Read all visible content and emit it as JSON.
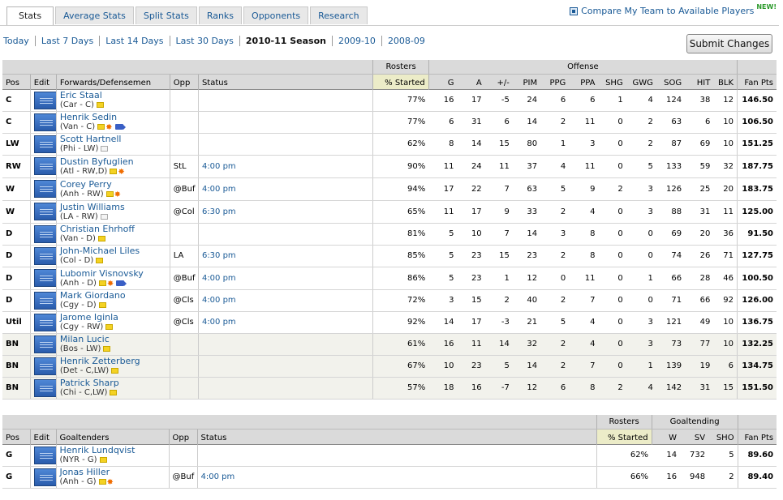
{
  "tabs": [
    "Stats",
    "Average Stats",
    "Split Stats",
    "Ranks",
    "Opponents",
    "Research"
  ],
  "compare_link": "Compare My Team to Available Players",
  "new_badge": "NEW!",
  "date_filters": [
    "Today",
    "Last 7 Days",
    "Last 14 Days",
    "Last 30 Days",
    "2010-11 Season",
    "2009-10",
    "2008-09"
  ],
  "submit_label": "Submit Changes",
  "skaters": {
    "group_rosters": "Rosters",
    "group_offense": "Offense",
    "headers": {
      "pos": "Pos",
      "edit": "Edit",
      "name": "Forwards/Defensemen",
      "opp": "Opp",
      "status": "Status",
      "pct": "% Started",
      "g": "G",
      "a": "A",
      "pm": "+/-",
      "pim": "PIM",
      "ppg": "PPG",
      "ppa": "PPA",
      "shg": "SHG",
      "gwg": "GWG",
      "sog": "SOG",
      "hit": "HIT",
      "blk": "BLK",
      "pts": "Fan Pts"
    },
    "rows": [
      {
        "pos": "C",
        "name": "Eric Staal",
        "info": "(Car - C)",
        "opp": "",
        "status": "",
        "pct": "77%",
        "g": "16",
        "a": "17",
        "pm": "-5",
        "pim": "24",
        "ppg": "6",
        "ppa": "6",
        "shg": "1",
        "gwg": "4",
        "sog": "124",
        "hit": "38",
        "blk": "12",
        "pts": "146.50"
      },
      {
        "pos": "C",
        "name": "Henrik Sedin",
        "info": "(Van - C)",
        "opp": "",
        "status": "",
        "pct": "77%",
        "g": "6",
        "a": "31",
        "pm": "6",
        "pim": "14",
        "ppg": "2",
        "ppa": "11",
        "shg": "0",
        "gwg": "2",
        "sog": "63",
        "hit": "6",
        "blk": "10",
        "pts": "106.50"
      },
      {
        "pos": "LW",
        "name": "Scott Hartnell",
        "info": "(Phi - LW)",
        "opp": "",
        "status": "",
        "pct": "62%",
        "g": "8",
        "a": "14",
        "pm": "15",
        "pim": "80",
        "ppg": "1",
        "ppa": "3",
        "shg": "0",
        "gwg": "2",
        "sog": "87",
        "hit": "69",
        "blk": "10",
        "pts": "151.25"
      },
      {
        "pos": "RW",
        "name": "Dustin Byfuglien",
        "info": "(Atl - RW,D)",
        "opp": "StL",
        "status": "4:00 pm",
        "pct": "90%",
        "g": "11",
        "a": "24",
        "pm": "11",
        "pim": "37",
        "ppg": "4",
        "ppa": "11",
        "shg": "0",
        "gwg": "5",
        "sog": "133",
        "hit": "59",
        "blk": "32",
        "pts": "187.75"
      },
      {
        "pos": "W",
        "name": "Corey Perry",
        "info": "(Anh - RW)",
        "opp": "@Buf",
        "status": "4:00 pm",
        "pct": "94%",
        "g": "17",
        "a": "22",
        "pm": "7",
        "pim": "63",
        "ppg": "5",
        "ppa": "9",
        "shg": "2",
        "gwg": "3",
        "sog": "126",
        "hit": "25",
        "blk": "20",
        "pts": "183.75"
      },
      {
        "pos": "W",
        "name": "Justin Williams",
        "info": "(LA - RW)",
        "opp": "@Col",
        "status": "6:30 pm",
        "pct": "65%",
        "g": "11",
        "a": "17",
        "pm": "9",
        "pim": "33",
        "ppg": "2",
        "ppa": "4",
        "shg": "0",
        "gwg": "3",
        "sog": "88",
        "hit": "31",
        "blk": "11",
        "pts": "125.00"
      },
      {
        "pos": "D",
        "name": "Christian Ehrhoff",
        "info": "(Van - D)",
        "opp": "",
        "status": "",
        "pct": "81%",
        "g": "5",
        "a": "10",
        "pm": "7",
        "pim": "14",
        "ppg": "3",
        "ppa": "8",
        "shg": "0",
        "gwg": "0",
        "sog": "69",
        "hit": "20",
        "blk": "36",
        "pts": "91.50"
      },
      {
        "pos": "D",
        "name": "John-Michael Liles",
        "info": "(Col - D)",
        "opp": "LA",
        "status": "6:30 pm",
        "pct": "85%",
        "g": "5",
        "a": "23",
        "pm": "15",
        "pim": "23",
        "ppg": "2",
        "ppa": "8",
        "shg": "0",
        "gwg": "0",
        "sog": "74",
        "hit": "26",
        "blk": "71",
        "pts": "127.75"
      },
      {
        "pos": "D",
        "name": "Lubomir Visnovsky",
        "info": "(Anh - D)",
        "opp": "@Buf",
        "status": "4:00 pm",
        "pct": "86%",
        "g": "5",
        "a": "23",
        "pm": "1",
        "pim": "12",
        "ppg": "0",
        "ppa": "11",
        "shg": "0",
        "gwg": "1",
        "sog": "66",
        "hit": "28",
        "blk": "46",
        "pts": "100.50"
      },
      {
        "pos": "D",
        "name": "Mark Giordano",
        "info": "(Cgy - D)",
        "opp": "@Cls",
        "status": "4:00 pm",
        "pct": "72%",
        "g": "3",
        "a": "15",
        "pm": "2",
        "pim": "40",
        "ppg": "2",
        "ppa": "7",
        "shg": "0",
        "gwg": "0",
        "sog": "71",
        "hit": "66",
        "blk": "92",
        "pts": "126.00"
      },
      {
        "pos": "Util",
        "name": "Jarome Iginla",
        "info": "(Cgy - RW)",
        "opp": "@Cls",
        "status": "4:00 pm",
        "pct": "92%",
        "g": "14",
        "a": "17",
        "pm": "-3",
        "pim": "21",
        "ppg": "5",
        "ppa": "4",
        "shg": "0",
        "gwg": "3",
        "sog": "121",
        "hit": "49",
        "blk": "10",
        "pts": "136.75"
      },
      {
        "pos": "BN",
        "name": "Milan Lucic",
        "info": "(Bos - LW)",
        "opp": "",
        "status": "",
        "pct": "61%",
        "g": "16",
        "a": "11",
        "pm": "14",
        "pim": "32",
        "ppg": "2",
        "ppa": "4",
        "shg": "0",
        "gwg": "3",
        "sog": "73",
        "hit": "77",
        "blk": "10",
        "pts": "132.25"
      },
      {
        "pos": "BN",
        "name": "Henrik Zetterberg",
        "info": "(Det - C,LW)",
        "opp": "",
        "status": "",
        "pct": "67%",
        "g": "10",
        "a": "23",
        "pm": "5",
        "pim": "14",
        "ppg": "2",
        "ppa": "7",
        "shg": "0",
        "gwg": "1",
        "sog": "139",
        "hit": "19",
        "blk": "6",
        "pts": "134.75"
      },
      {
        "pos": "BN",
        "name": "Patrick Sharp",
        "info": "(Chi - C,LW)",
        "opp": "",
        "status": "",
        "pct": "57%",
        "g": "18",
        "a": "16",
        "pm": "-7",
        "pim": "12",
        "ppg": "6",
        "ppa": "8",
        "shg": "2",
        "gwg": "4",
        "sog": "142",
        "hit": "31",
        "blk": "15",
        "pts": "151.50"
      }
    ]
  },
  "goalies": {
    "group_rosters": "Rosters",
    "group_goaltending": "Goaltending",
    "headers": {
      "pos": "Pos",
      "edit": "Edit",
      "name": "Goaltenders",
      "opp": "Opp",
      "status": "Status",
      "pct": "% Started",
      "w": "W",
      "sv": "SV",
      "sho": "SHO",
      "pts": "Fan Pts"
    },
    "rows": [
      {
        "pos": "G",
        "name": "Henrik Lundqvist",
        "info": "(NYR - G)",
        "opp": "",
        "status": "",
        "pct": "62%",
        "w": "14",
        "sv": "732",
        "sho": "5",
        "pts": "89.60"
      },
      {
        "pos": "G",
        "name": "Jonas Hiller",
        "info": "(Anh - G)",
        "opp": "@Buf",
        "status": "4:00 pm",
        "pct": "66%",
        "w": "16",
        "sv": "948",
        "sho": "2",
        "pts": "89.40"
      }
    ]
  }
}
